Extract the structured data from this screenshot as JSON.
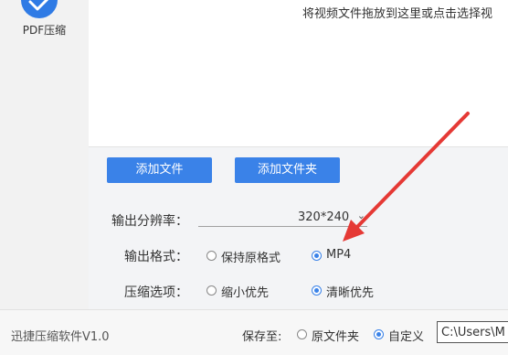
{
  "sidebar": {
    "tool": {
      "label": "PDF压缩",
      "icon": "pdf-compress-icon"
    }
  },
  "main": {
    "hint": "将视频文件拖放到这里或点击选择视"
  },
  "buttons": {
    "add_file": "添加文件",
    "add_folder": "添加文件夹"
  },
  "settings": {
    "resolution": {
      "label": "输出分辨率：",
      "value": "320*240"
    },
    "format": {
      "label": "输出格式：",
      "options": [
        "保持原格式",
        "MP4"
      ],
      "selected": "MP4"
    },
    "compress": {
      "label": "压缩选项：",
      "options": [
        "缩小优先",
        "清晰优先"
      ],
      "selected": "清晰优先"
    }
  },
  "footer": {
    "version": "迅捷压缩软件V1.0",
    "save_to_label": "保存至:",
    "save_options": [
      "原文件夹",
      "自定义"
    ],
    "save_selected": "自定义",
    "path_value": "C:\\Users\\M"
  },
  "colors": {
    "accent": "#3a82e8",
    "annotation_arrow": "#e53935"
  }
}
